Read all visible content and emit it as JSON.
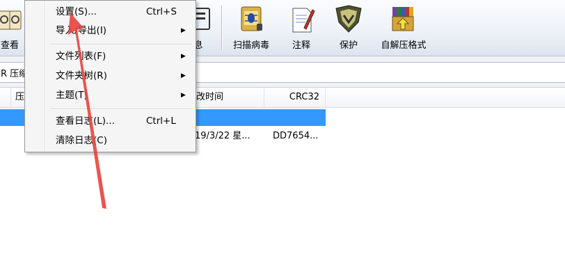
{
  "toolbar": {
    "buttons": [
      {
        "label": "查看",
        "icon": "view-icon"
      },
      {
        "label": "息",
        "icon": "info-icon"
      },
      {
        "label": "扫描病毒",
        "icon": "scan-virus-icon"
      },
      {
        "label": "注释",
        "icon": "comment-icon"
      },
      {
        "label": "保护",
        "icon": "protect-icon"
      },
      {
        "label": "自解压格式",
        "icon": "sfx-icon"
      }
    ]
  },
  "address": {
    "text": "R 压缩"
  },
  "list": {
    "columns": [
      "压",
      "改时间",
      "CRC32"
    ],
    "rows": [
      {
        "date": "",
        "crc": "",
        "selected": true
      },
      {
        "date": "19/3/22 星...",
        "crc": "DD7654...",
        "selected": false
      }
    ]
  },
  "menu": {
    "items": [
      {
        "label": "设置(S)...",
        "shortcut": "Ctrl+S",
        "submenu": false
      },
      {
        "label": "导入/导出(I)",
        "shortcut": "",
        "submenu": true
      },
      {
        "label": "文件列表(F)",
        "shortcut": "",
        "submenu": true
      },
      {
        "label": "文件夹树(R)",
        "shortcut": "",
        "submenu": true
      },
      {
        "label": "主题(T)",
        "shortcut": "",
        "submenu": true
      },
      {
        "label": "查看日志(L)...",
        "shortcut": "Ctrl+L",
        "submenu": false
      },
      {
        "label": "清除日志(C)",
        "shortcut": "",
        "submenu": false
      }
    ],
    "submenu_arrow": "▶"
  },
  "colors": {
    "selection": "#3399ff",
    "annotation": "#e8423c"
  }
}
